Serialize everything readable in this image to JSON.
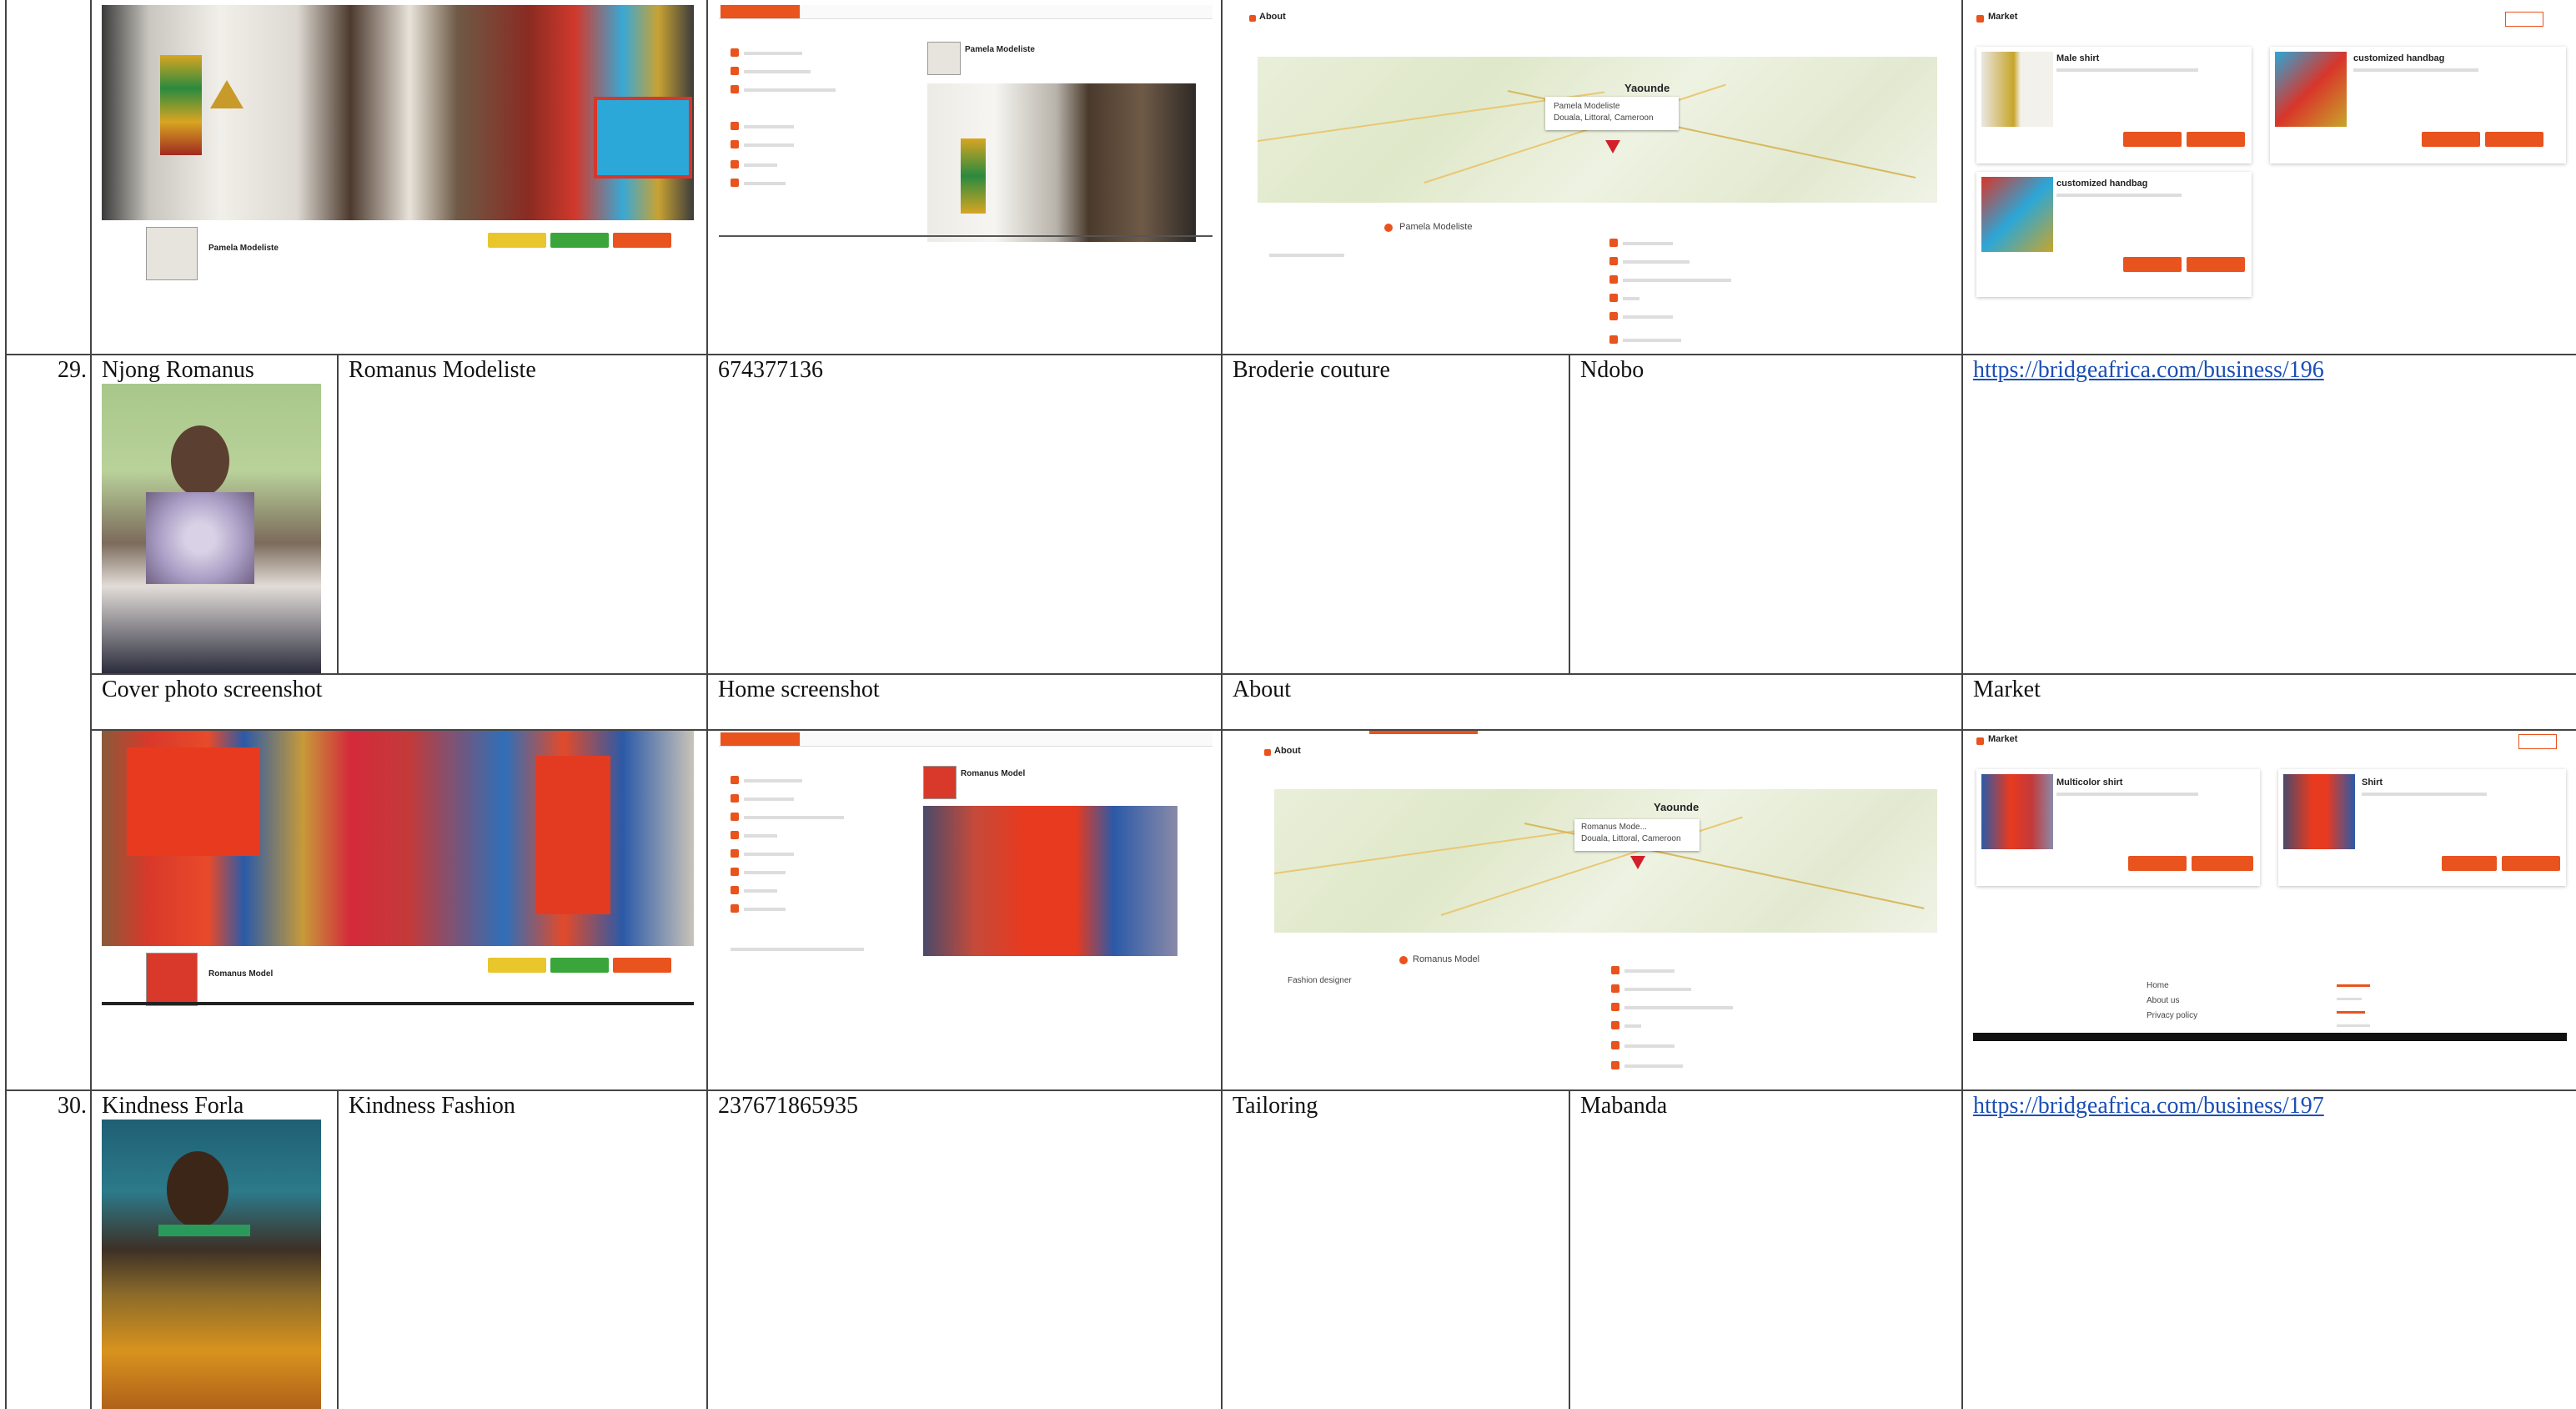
{
  "colors": {
    "accent": "#e8531e",
    "link": "#1a4fb5",
    "yellow": "#e9c62b",
    "green": "#3aa53a",
    "grid": "#444444"
  },
  "rows": [
    {
      "number": "29.",
      "owner": "Njong Romanus",
      "business": "Romanus Modeliste",
      "phone": "674377136",
      "category": "Broderie couture",
      "location": "Ndobo",
      "url": "https://bridgeafrica.com/business/196"
    },
    {
      "number": "30.",
      "owner": "Kindness Forla",
      "business": "Kindness Fashion",
      "phone": "237671865935",
      "category": "Tailoring",
      "location": "Mabanda",
      "url": "https://bridgeafrica.com/business/197"
    }
  ],
  "section_headers": {
    "cover": "Cover photo screenshot",
    "home": "Home screenshot",
    "about": "About",
    "market": "Market"
  },
  "shots": {
    "top": {
      "profile_name": "Pamela Modeliste",
      "home_name": "Pamela Modeliste",
      "about_title": "About",
      "map_city": "Yaounde",
      "map_popup_1": "Pamela Modeliste",
      "map_popup_2": "Douala, Littoral, Cameroon",
      "about_name": "Pamela Modeliste",
      "market_title": "Market",
      "products": [
        "Male shirt",
        "customized handbag",
        "customized handbag"
      ]
    },
    "bottom": {
      "profile_name": "Romanus Model",
      "home_name": "Romanus Model",
      "about_title": "About",
      "map_city": "Yaounde",
      "map_popup_1": "Romanus Mode...",
      "map_popup_2": "Douala, Littoral, Cameroon",
      "about_name": "Romanus Model",
      "about_desc": "Fashion designer",
      "market_title": "Market",
      "products": [
        "Multicolor shirt",
        "Shirt"
      ],
      "footer_links": [
        "Home",
        "About us",
        "Privacy policy"
      ]
    }
  }
}
